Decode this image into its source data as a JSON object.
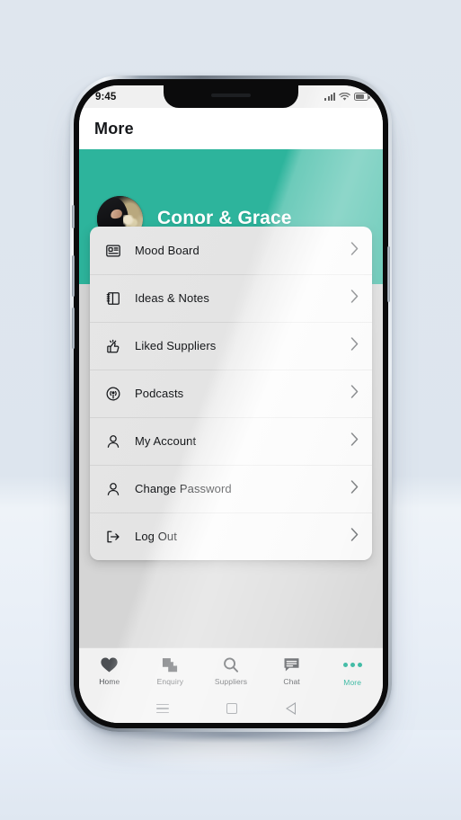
{
  "status_bar": {
    "time": "9:45",
    "signal_icon": "signal-bars-icon",
    "wifi_icon": "wifi-icon",
    "battery_icon": "battery-icon"
  },
  "navbar": {
    "title": "More"
  },
  "profile": {
    "name": "Conor & Grace",
    "avatar_alt": "couple-photo",
    "background_color": "#2db49c"
  },
  "menu": {
    "items": [
      {
        "label": "Mood Board",
        "icon": "mood-board-icon",
        "chevron": "chevron-right-icon"
      },
      {
        "label": "Ideas & Notes",
        "icon": "notebook-icon",
        "chevron": "chevron-right-icon"
      },
      {
        "label": "Liked Suppliers",
        "icon": "thumbs-up-icon",
        "chevron": "chevron-right-icon"
      },
      {
        "label": "Podcasts",
        "icon": "podcast-icon",
        "chevron": "chevron-right-icon"
      },
      {
        "label": "My Account",
        "icon": "person-icon",
        "chevron": "chevron-right-icon"
      },
      {
        "label": "Change Password",
        "icon": "person-icon",
        "chevron": "chevron-right-icon"
      },
      {
        "label": "Log Out",
        "icon": "logout-icon",
        "chevron": "chevron-right-icon"
      }
    ]
  },
  "tabbar": {
    "active_color": "#2db49c",
    "inactive_color": "#4c4f53",
    "tabs": [
      {
        "label": "Home",
        "icon": "heart-icon",
        "active": false
      },
      {
        "label": "Enquiry",
        "icon": "documents-icon",
        "active": false
      },
      {
        "label": "Suppliers",
        "icon": "search-icon",
        "active": false
      },
      {
        "label": "Chat",
        "icon": "chat-icon",
        "active": false
      },
      {
        "label": "More",
        "icon": "more-dots-icon",
        "active": true
      }
    ]
  },
  "android_nav": {
    "recents_icon": "menu-lines-icon",
    "home_icon": "square-home-icon",
    "back_icon": "back-triangle-icon"
  }
}
